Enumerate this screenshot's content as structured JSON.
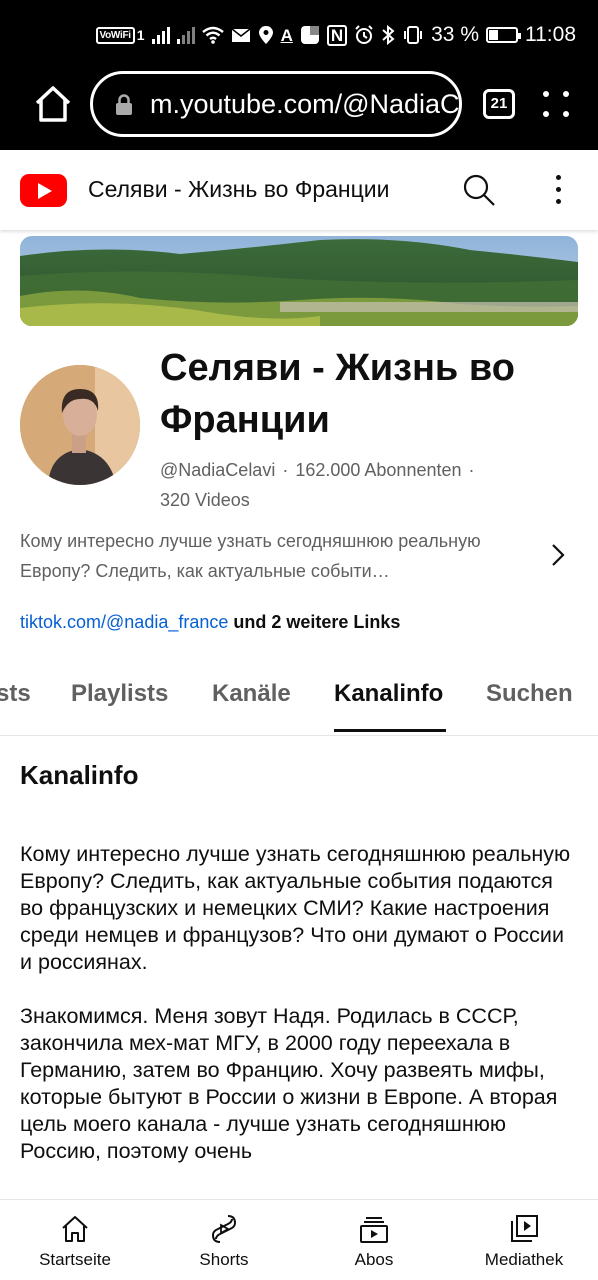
{
  "status_bar": {
    "vowifi": "VoWiFi",
    "vowifi_sim": "1",
    "battery_percent": "33 %",
    "battery_level": 0.33,
    "time": "11:08",
    "icons": [
      "signal-icon",
      "signal-icon",
      "wifi-icon",
      "mail-icon",
      "location-icon",
      "text-icon",
      "app-icon",
      "nfc-icon",
      "alarm-icon",
      "bluetooth-icon",
      "vibrate-icon",
      "battery-icon"
    ]
  },
  "browser": {
    "url": "m.youtube.com/@NadiaC",
    "tab_count": "21"
  },
  "header": {
    "title": "Селяви - Жизнь во Франции"
  },
  "channel": {
    "name": "Селяви - Жизнь во Франции",
    "handle": "@NadiaCelavi",
    "subscribers": "162.000 Abonnenten",
    "videos": "320 Videos",
    "separator": "·",
    "description_preview": "Кому интересно лучше узнать сегодняшнюю реальную Европу? Следить, как актуальные событи…",
    "link": "tiktok.com/@nadia_france",
    "more_links": " und 2 weitere Links"
  },
  "tabs": [
    {
      "label": "sts"
    },
    {
      "label": "Playlists"
    },
    {
      "label": "Kanäle"
    },
    {
      "label": "Kanalinfo"
    },
    {
      "label": "Suchen"
    }
  ],
  "about": {
    "title": "Kanalinfo",
    "paragraphs": [
      "Кому интересно лучше узнать сегодняшнюю реальную Европу? Следить, как актуальные события подаются во французских и немецких СМИ? Какие настроения среди немцев и французов? Что они думают о России и россиянах.",
      "Знакомимся. Меня зовут Надя. Родилась в СССР, закончила мех-мат МГУ, в 2000 году переехала в Германию, затем во Францию. Хочу развеять мифы, которые бытуют в России о жизни в Европе. А вторая цель моего канала - лучше узнать сегодняшнюю Россию, поэтому очень"
    ]
  },
  "bottom_nav": [
    {
      "label": "Startseite",
      "icon": "home-icon"
    },
    {
      "label": "Shorts",
      "icon": "shorts-icon"
    },
    {
      "label": "Abos",
      "icon": "subscriptions-icon"
    },
    {
      "label": "Mediathek",
      "icon": "library-icon"
    }
  ],
  "colors": {
    "youtube_red": "#ff0000",
    "link_blue": "#065fd4",
    "secondary_text": "#606060"
  }
}
